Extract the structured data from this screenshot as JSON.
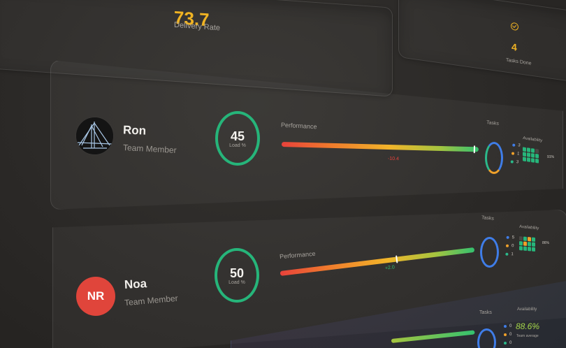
{
  "kpi": {
    "delivery_rate_value": "73.7",
    "delivery_rate_label": "Delivery Rate",
    "tasks_done_value": "4",
    "tasks_done_label": "Tasks Done"
  },
  "labels": {
    "performance": "Performance",
    "tasks": "Tasks",
    "availability": "Availability",
    "load": "Load %"
  },
  "members": [
    {
      "name": "Ron",
      "role": "Team Member",
      "load": "45",
      "performance_delta": "-10.4",
      "performance_marker": 0.98,
      "task_counts": [
        "3",
        "1",
        "3"
      ],
      "availability_pct": "91%",
      "avatar": "bridge-photo-avatar"
    },
    {
      "name": "Noa",
      "initials": "NR",
      "role": "Team Member",
      "load": "50",
      "performance_delta": "+2.0",
      "performance_marker": 0.6,
      "task_counts": [
        "5",
        "0",
        "1"
      ],
      "availability_pct": "86%",
      "avatar": "initials-avatar"
    }
  ],
  "third_card": {
    "tasks_label": "Tasks",
    "availability_label": "Availability",
    "team_pct": "88.6%",
    "team_sub": "Team average",
    "task_counts": [
      "0",
      "0",
      "0"
    ]
  },
  "colors": {
    "accent": "#f0b323",
    "good": "#26b57a",
    "bad": "#e8423b",
    "avatar_red": "#e0453b",
    "ring_blue": "#3f7de8"
  }
}
